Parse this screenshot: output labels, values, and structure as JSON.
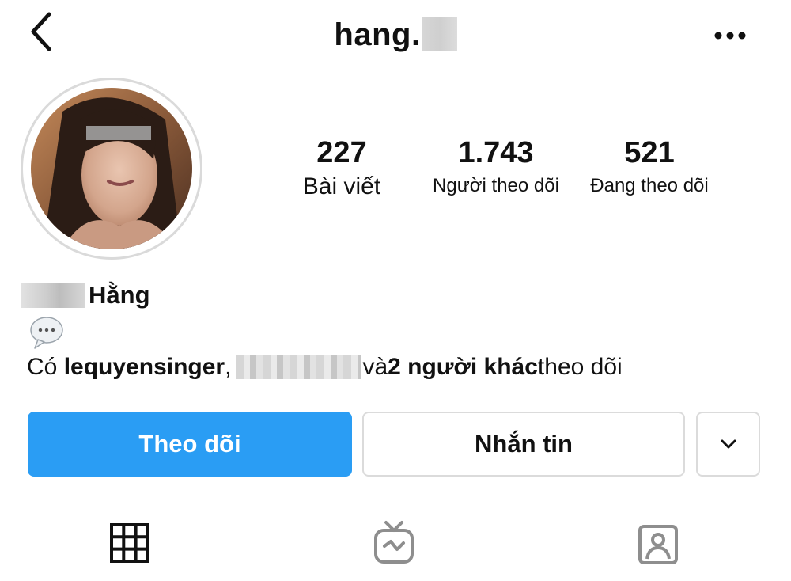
{
  "header": {
    "username": "hang.",
    "username_censored": true
  },
  "profile": {
    "stats": [
      {
        "value": "227",
        "label": "Bài viết"
      },
      {
        "value": "1.743",
        "label": "Người theo dõi"
      },
      {
        "value": "521",
        "label": "Đang theo dõi"
      }
    ],
    "name": "Hằng",
    "bio_emoji": "💬",
    "followed_by": {
      "prefix": "Có ",
      "user1": "lequyensinger",
      "separator": ", ",
      "and": "và ",
      "others": "2 người khác",
      "suffix": " theo dõi"
    }
  },
  "actions": {
    "follow_label": "Theo dõi",
    "message_label": "Nhắn tin"
  },
  "icons": {
    "back": "chevron-left-icon",
    "more": "more-horizontal-icon",
    "suggest": "chevron-down-icon",
    "tabs": [
      "grid-icon",
      "igtv-icon",
      "tagged-icon"
    ]
  },
  "colors": {
    "follow_button": "#2a9df4",
    "border": "#dbdbdb",
    "icon_gray": "#8e8e8e"
  }
}
